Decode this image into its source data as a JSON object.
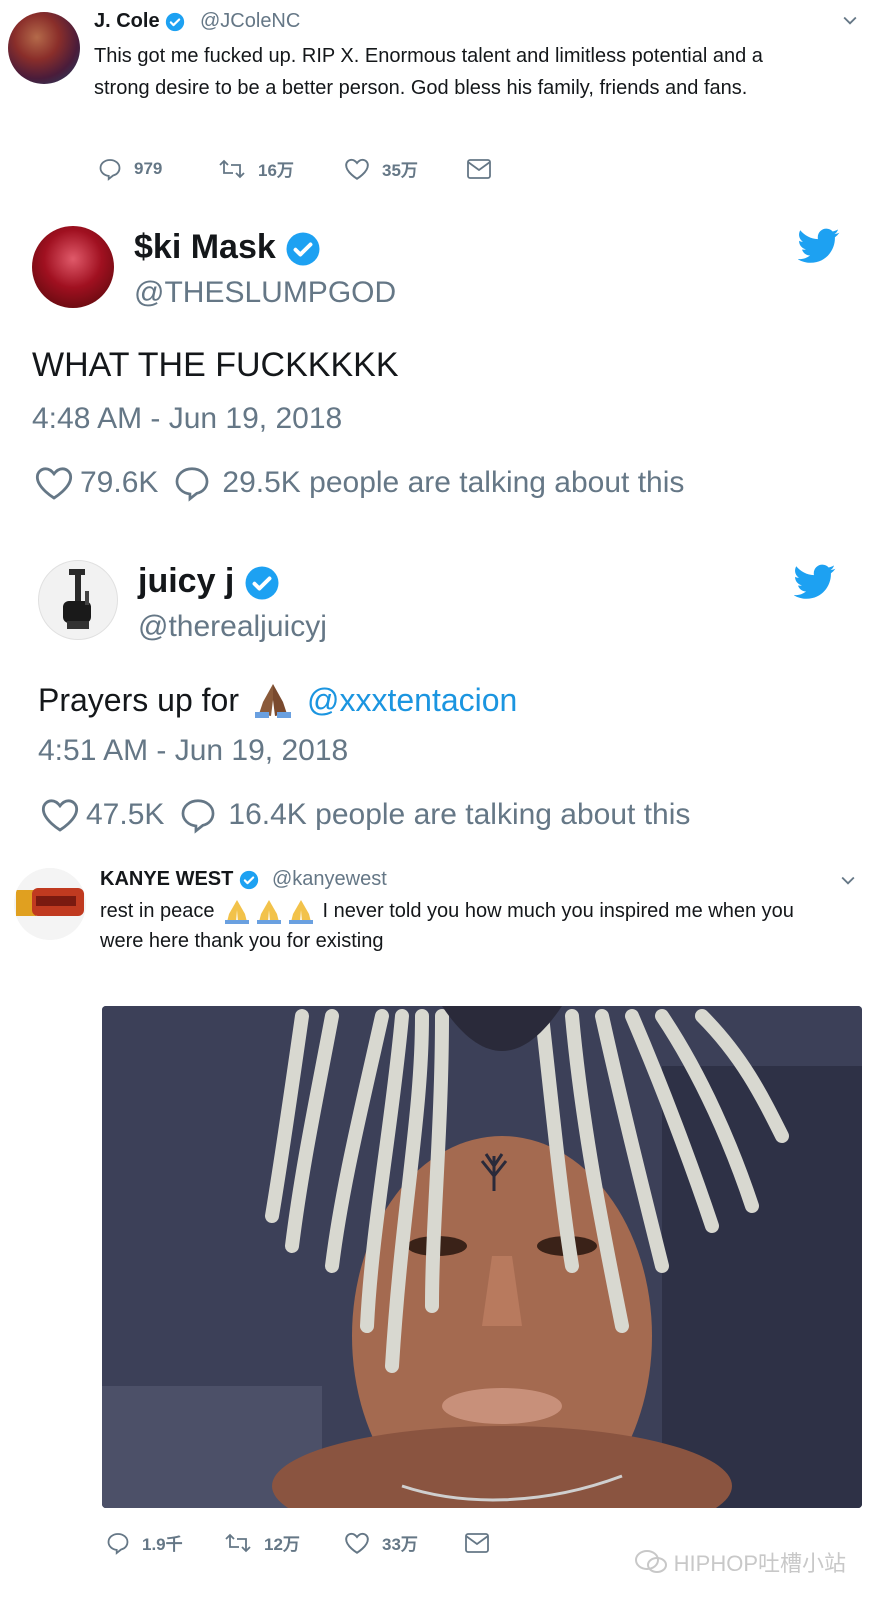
{
  "tweet1": {
    "name": "J. Cole",
    "handle": "@JColeNC",
    "text_line1": "This got me fucked up. RIP X. Enormous talent and limitless potential and a",
    "text_line2": "strong desire to be a better person. God bless his family, friends and fans.",
    "replies": "979",
    "retweets": "16万",
    "likes": "35万"
  },
  "tweet2": {
    "name": "$ki Mask",
    "handle": "@THESLUMPGOD",
    "text": "WHAT THE FUCKKKKK",
    "time": "4:48 AM - Jun 19, 2018",
    "likes": "79.6K",
    "talking": "29.5K people are talking about this"
  },
  "tweet3": {
    "name": "juicy j",
    "handle": "@therealjuicyj",
    "text_prefix": "Prayers up for",
    "mention": "@xxxtentacion",
    "time": "4:51 AM - Jun 19, 2018",
    "likes": "47.5K",
    "talking": "16.4K people are talking about this"
  },
  "tweet4": {
    "name": "KANYE WEST",
    "handle": "@kanyewest",
    "text_part1": "rest in peace",
    "text_part2": "I never told you how much you inspired me when you",
    "text_line2": "were here   thank you for existing",
    "replies": "1.9千",
    "retweets": "12万",
    "likes": "33万"
  },
  "watermark": "HIPHOP吐槽小站",
  "colors": {
    "twitter_blue": "#1da1f2",
    "gray": "#657786",
    "text": "#14171a",
    "mention": "#1b95e0"
  },
  "icons": [
    "verified-badge-icon",
    "chevron-down-icon",
    "reply-icon",
    "retweet-icon",
    "like-icon",
    "dm-icon",
    "twitter-bird-icon",
    "folded-hands-icon",
    "wechat-icon"
  ]
}
